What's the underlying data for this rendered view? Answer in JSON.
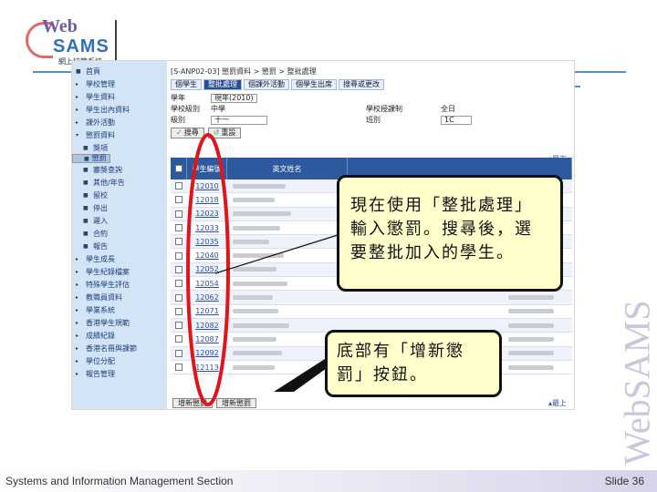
{
  "logo": {
    "web": "Web",
    "sams": "SAMS",
    "subtitle": "網上校管系統"
  },
  "sidebar": {
    "items": [
      {
        "label": "首頁"
      },
      {
        "label": "學校管理"
      },
      {
        "label": "學生資料"
      },
      {
        "label": "學生出內資料"
      },
      {
        "label": "課外活動"
      },
      {
        "label": "懲罰資料"
      },
      {
        "label": "獎項"
      },
      {
        "label": "懲罰"
      },
      {
        "label": "審獎查詢"
      },
      {
        "label": "其他/年告"
      },
      {
        "label": "留校"
      },
      {
        "label": "停出"
      },
      {
        "label": "遲入"
      },
      {
        "label": "合約"
      },
      {
        "label": "報告"
      },
      {
        "label": "學生成長"
      },
      {
        "label": "學生紀錄檔案"
      },
      {
        "label": "特殊學生評估"
      },
      {
        "label": "教職員資料"
      },
      {
        "label": "學業系統"
      },
      {
        "label": "香港學生規範"
      },
      {
        "label": "成績紀錄"
      },
      {
        "label": "香港名冊與課節"
      },
      {
        "label": "學位分配"
      },
      {
        "label": "報告管理"
      }
    ]
  },
  "screen": {
    "breadcrumb": "[S-ANP02-03] 懲罰資料 > 懲罰 > 整批處理",
    "tabs": [
      "個學生",
      "整批處理",
      "個課外活動",
      "個學生出席",
      "搜尋或更改"
    ],
    "form": {
      "year_label": "學年",
      "year_value": "現年(2010)",
      "level_label": "學校級別",
      "level_value": "中學",
      "session_label": "學校授課制",
      "session_value": "全日",
      "class_level_label": "級別",
      "class_level_value": "十一",
      "class_label": "班別",
      "class_value": "1C"
    },
    "search_button": "搜尋",
    "clear_button": "重設",
    "grid_header": {
      "regno": "學生編號",
      "name": "英文姓名"
    },
    "reg_numbers": [
      "12010",
      "12018",
      "12023",
      "12033",
      "12035",
      "12040",
      "12052",
      "12054",
      "12062",
      "12071",
      "12082",
      "12087",
      "12092",
      "12113"
    ],
    "bottom_link": "最上",
    "top_link": "最下",
    "add_button": "增新懲罰"
  },
  "callouts": {
    "main": "現在使用「整批處理」輸入懲罰。搜尋後，選要整批加入的學生。",
    "bottom": "底部有「增新懲罰」按鈕。"
  },
  "footer": {
    "left": "Systems and Information Management Section",
    "right": "Slide 36"
  },
  "watermark": "WebSAMS"
}
